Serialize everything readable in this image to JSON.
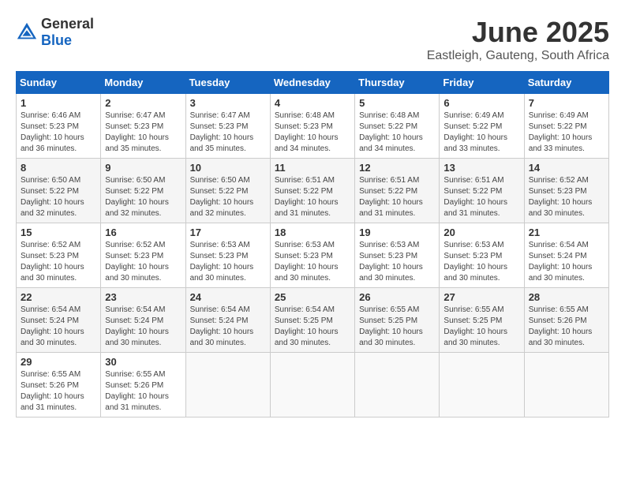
{
  "header": {
    "logo_general": "General",
    "logo_blue": "Blue",
    "title": "June 2025",
    "subtitle": "Eastleigh, Gauteng, South Africa"
  },
  "weekdays": [
    "Sunday",
    "Monday",
    "Tuesday",
    "Wednesday",
    "Thursday",
    "Friday",
    "Saturday"
  ],
  "weeks": [
    [
      {
        "day": "1",
        "sunrise": "Sunrise: 6:46 AM",
        "sunset": "Sunset: 5:23 PM",
        "daylight": "Daylight: 10 hours and 36 minutes."
      },
      {
        "day": "2",
        "sunrise": "Sunrise: 6:47 AM",
        "sunset": "Sunset: 5:23 PM",
        "daylight": "Daylight: 10 hours and 35 minutes."
      },
      {
        "day": "3",
        "sunrise": "Sunrise: 6:47 AM",
        "sunset": "Sunset: 5:23 PM",
        "daylight": "Daylight: 10 hours and 35 minutes."
      },
      {
        "day": "4",
        "sunrise": "Sunrise: 6:48 AM",
        "sunset": "Sunset: 5:23 PM",
        "daylight": "Daylight: 10 hours and 34 minutes."
      },
      {
        "day": "5",
        "sunrise": "Sunrise: 6:48 AM",
        "sunset": "Sunset: 5:22 PM",
        "daylight": "Daylight: 10 hours and 34 minutes."
      },
      {
        "day": "6",
        "sunrise": "Sunrise: 6:49 AM",
        "sunset": "Sunset: 5:22 PM",
        "daylight": "Daylight: 10 hours and 33 minutes."
      },
      {
        "day": "7",
        "sunrise": "Sunrise: 6:49 AM",
        "sunset": "Sunset: 5:22 PM",
        "daylight": "Daylight: 10 hours and 33 minutes."
      }
    ],
    [
      {
        "day": "8",
        "sunrise": "Sunrise: 6:50 AM",
        "sunset": "Sunset: 5:22 PM",
        "daylight": "Daylight: 10 hours and 32 minutes."
      },
      {
        "day": "9",
        "sunrise": "Sunrise: 6:50 AM",
        "sunset": "Sunset: 5:22 PM",
        "daylight": "Daylight: 10 hours and 32 minutes."
      },
      {
        "day": "10",
        "sunrise": "Sunrise: 6:50 AM",
        "sunset": "Sunset: 5:22 PM",
        "daylight": "Daylight: 10 hours and 32 minutes."
      },
      {
        "day": "11",
        "sunrise": "Sunrise: 6:51 AM",
        "sunset": "Sunset: 5:22 PM",
        "daylight": "Daylight: 10 hours and 31 minutes."
      },
      {
        "day": "12",
        "sunrise": "Sunrise: 6:51 AM",
        "sunset": "Sunset: 5:22 PM",
        "daylight": "Daylight: 10 hours and 31 minutes."
      },
      {
        "day": "13",
        "sunrise": "Sunrise: 6:51 AM",
        "sunset": "Sunset: 5:22 PM",
        "daylight": "Daylight: 10 hours and 31 minutes."
      },
      {
        "day": "14",
        "sunrise": "Sunrise: 6:52 AM",
        "sunset": "Sunset: 5:23 PM",
        "daylight": "Daylight: 10 hours and 30 minutes."
      }
    ],
    [
      {
        "day": "15",
        "sunrise": "Sunrise: 6:52 AM",
        "sunset": "Sunset: 5:23 PM",
        "daylight": "Daylight: 10 hours and 30 minutes."
      },
      {
        "day": "16",
        "sunrise": "Sunrise: 6:52 AM",
        "sunset": "Sunset: 5:23 PM",
        "daylight": "Daylight: 10 hours and 30 minutes."
      },
      {
        "day": "17",
        "sunrise": "Sunrise: 6:53 AM",
        "sunset": "Sunset: 5:23 PM",
        "daylight": "Daylight: 10 hours and 30 minutes."
      },
      {
        "day": "18",
        "sunrise": "Sunrise: 6:53 AM",
        "sunset": "Sunset: 5:23 PM",
        "daylight": "Daylight: 10 hours and 30 minutes."
      },
      {
        "day": "19",
        "sunrise": "Sunrise: 6:53 AM",
        "sunset": "Sunset: 5:23 PM",
        "daylight": "Daylight: 10 hours and 30 minutes."
      },
      {
        "day": "20",
        "sunrise": "Sunrise: 6:53 AM",
        "sunset": "Sunset: 5:23 PM",
        "daylight": "Daylight: 10 hours and 30 minutes."
      },
      {
        "day": "21",
        "sunrise": "Sunrise: 6:54 AM",
        "sunset": "Sunset: 5:24 PM",
        "daylight": "Daylight: 10 hours and 30 minutes."
      }
    ],
    [
      {
        "day": "22",
        "sunrise": "Sunrise: 6:54 AM",
        "sunset": "Sunset: 5:24 PM",
        "daylight": "Daylight: 10 hours and 30 minutes."
      },
      {
        "day": "23",
        "sunrise": "Sunrise: 6:54 AM",
        "sunset": "Sunset: 5:24 PM",
        "daylight": "Daylight: 10 hours and 30 minutes."
      },
      {
        "day": "24",
        "sunrise": "Sunrise: 6:54 AM",
        "sunset": "Sunset: 5:24 PM",
        "daylight": "Daylight: 10 hours and 30 minutes."
      },
      {
        "day": "25",
        "sunrise": "Sunrise: 6:54 AM",
        "sunset": "Sunset: 5:25 PM",
        "daylight": "Daylight: 10 hours and 30 minutes."
      },
      {
        "day": "26",
        "sunrise": "Sunrise: 6:55 AM",
        "sunset": "Sunset: 5:25 PM",
        "daylight": "Daylight: 10 hours and 30 minutes."
      },
      {
        "day": "27",
        "sunrise": "Sunrise: 6:55 AM",
        "sunset": "Sunset: 5:25 PM",
        "daylight": "Daylight: 10 hours and 30 minutes."
      },
      {
        "day": "28",
        "sunrise": "Sunrise: 6:55 AM",
        "sunset": "Sunset: 5:26 PM",
        "daylight": "Daylight: 10 hours and 30 minutes."
      }
    ],
    [
      {
        "day": "29",
        "sunrise": "Sunrise: 6:55 AM",
        "sunset": "Sunset: 5:26 PM",
        "daylight": "Daylight: 10 hours and 31 minutes."
      },
      {
        "day": "30",
        "sunrise": "Sunrise: 6:55 AM",
        "sunset": "Sunset: 5:26 PM",
        "daylight": "Daylight: 10 hours and 31 minutes."
      },
      null,
      null,
      null,
      null,
      null
    ]
  ]
}
